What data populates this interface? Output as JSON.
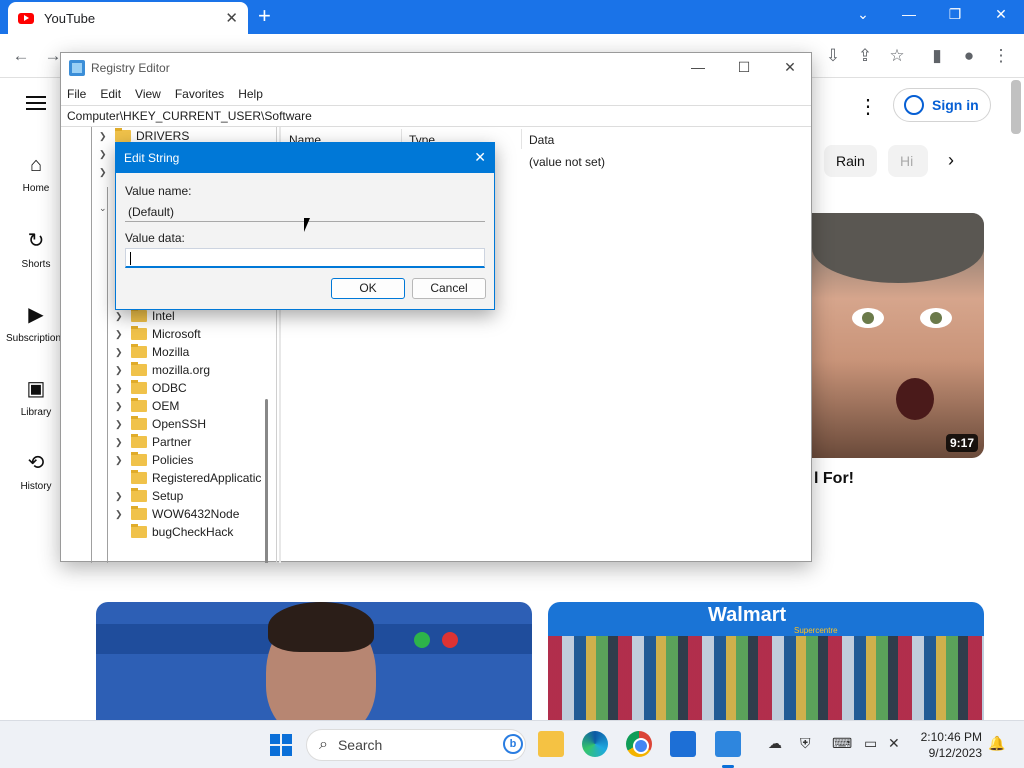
{
  "browser": {
    "tab_title": "YouTube",
    "tab_close": "✕",
    "new_tab": "+",
    "controls": {
      "chevron": "⌄",
      "minimize": "—",
      "restore": "❐",
      "close": "✕"
    }
  },
  "youtube": {
    "nav": [
      {
        "label": "Home",
        "icon": "⌂"
      },
      {
        "label": "Shorts",
        "icon": "↻"
      },
      {
        "label": "Subscriptions",
        "icon": "▶"
      },
      {
        "label": "Library",
        "icon": "▣"
      },
      {
        "label": "History",
        "icon": "⟲"
      }
    ],
    "sign_in": "Sign in",
    "chips": [
      "Rain",
      "Hi"
    ],
    "chip_next": "›",
    "video_duration": "9:17",
    "video_title_fragment": "l For!",
    "walmart_text": "Walmart",
    "walmart_sub": "Supercentre"
  },
  "regedit": {
    "title": "Registry Editor",
    "menu": [
      "File",
      "Edit",
      "View",
      "Favorites",
      "Help"
    ],
    "address": "Computer\\HKEY_CURRENT_USER\\Software",
    "tree_top": "DRIVERS",
    "tree_items": [
      "Intel",
      "Microsoft",
      "Mozilla",
      "mozilla.org",
      "ODBC",
      "OEM",
      "OpenSSH",
      "Partner",
      "Policies",
      "RegisteredApplicatic",
      "Setup",
      "WOW6432Node",
      "bugCheckHack"
    ],
    "columns": [
      "Name",
      "Type",
      "Data"
    ],
    "data_value": "(value not set)",
    "win_buttons": {
      "minimize": "—",
      "maximize": "☐",
      "close": "✕"
    }
  },
  "dialog": {
    "title": "Edit String",
    "close": "✕",
    "value_name_label": "Value name:",
    "value_name": "(Default)",
    "value_data_label": "Value data:",
    "value_data": "",
    "ok_label": "OK",
    "cancel_label": "Cancel"
  },
  "taskbar": {
    "search_label": "Search",
    "bing": "b",
    "time": "2:10:46 PM",
    "date": "9/12/2023"
  },
  "colors": {
    "chrome_blue": "#1a73e8",
    "dialog_accent": "#0078d7",
    "youtube_red": "#ff0000",
    "signin_blue": "#065fd4"
  }
}
